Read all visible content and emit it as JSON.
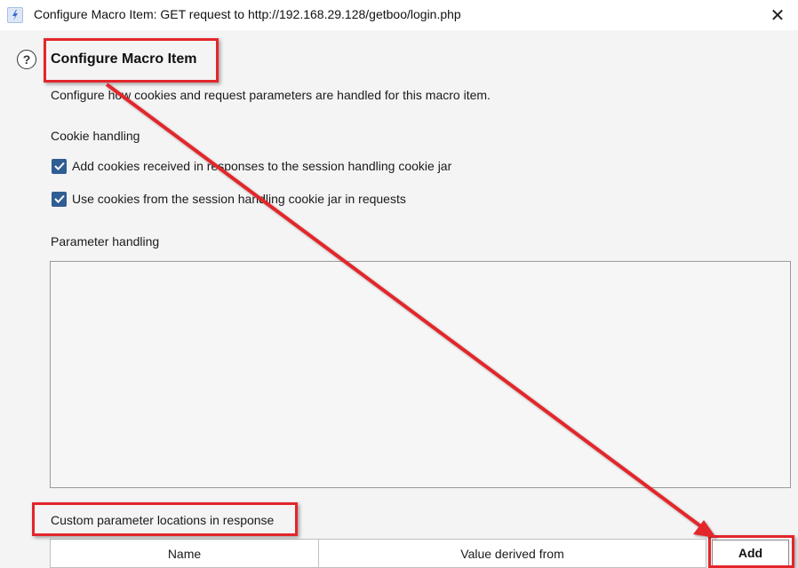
{
  "window": {
    "title": "Configure Macro Item: GET request to http://192.168.29.128/getboo/login.php",
    "close_glyph": "✕",
    "app_icon": "lightning-icon"
  },
  "header": {
    "help_glyph": "?",
    "heading": "Configure Macro Item",
    "description": "Configure how cookies and request parameters are handled for this macro item."
  },
  "cookie_handling": {
    "label": "Cookie handling",
    "options": [
      {
        "label": "Add cookies received in responses to the session handling cookie jar",
        "checked": true
      },
      {
        "label": "Use cookies from the session handling cookie jar in requests",
        "checked": true
      }
    ]
  },
  "parameter_handling": {
    "label": "Parameter handling"
  },
  "custom_locations": {
    "label": "Custom parameter locations in response",
    "columns": [
      "Name",
      "Value derived from"
    ],
    "add_label": "Add"
  },
  "colors": {
    "annotation": "#e3262b",
    "checkbox": "#2f5d94"
  }
}
